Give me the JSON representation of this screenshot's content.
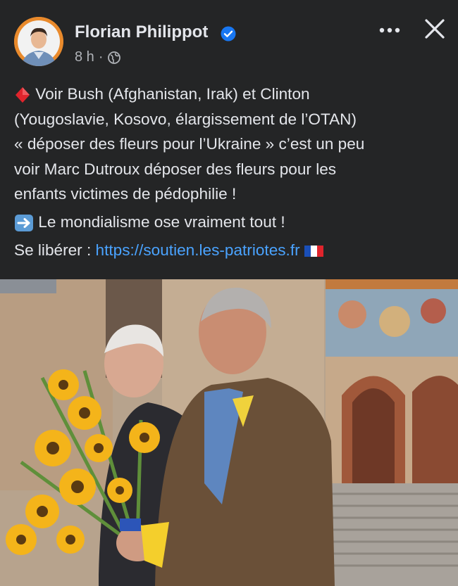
{
  "post": {
    "author": "Florian Philippot",
    "time": "8 h",
    "dot": "·",
    "line1": "Voir Bush (Afghanistan, Irak) et Clinton",
    "line2": "(Yougoslavie, Kosovo, élargissement de l’OTAN)",
    "line3": "« déposer des fleurs pour l’Ukraine » c’est un peu",
    "line4": "voir Marc Dutroux déposer des fleurs pour les",
    "line5": "enfants victimes de pédophilie !",
    "line6": "Le mondialisme ose vraiment tout !",
    "line7_prefix": "Se libérer :",
    "link": "https://soutien.les-patriotes.fr"
  },
  "icons": {
    "more": "more-options-icon",
    "close": "close-icon",
    "verified": "verified-badge-icon",
    "globe": "globe-icon",
    "diamond": "red-diamond-emoji",
    "arrow": "right-arrow-emoji",
    "flag": "french-flag-emoji"
  },
  "colors": {
    "background": "#242526",
    "text": "#e4e6eb",
    "secondary": "#b0b3b8",
    "link": "#4aa3ff",
    "verified": "#1877f2"
  }
}
